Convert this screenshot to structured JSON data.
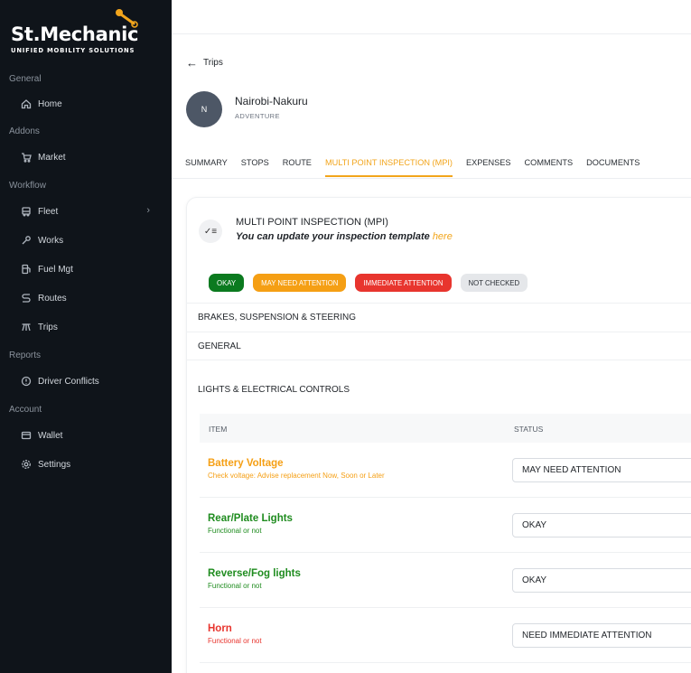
{
  "brand": {
    "name": "St.Mechanic",
    "tagline": "UNIFIED MOBILITY SOLUTIONS",
    "accent": "#f2a51c",
    "sidebar_bg": "#0f141a"
  },
  "sidebar": {
    "sections": [
      {
        "label": "General",
        "items": [
          {
            "label": "Home",
            "icon": "home-icon"
          }
        ]
      },
      {
        "label": "Addons",
        "items": [
          {
            "label": "Market",
            "icon": "cart-icon"
          }
        ]
      },
      {
        "label": "Workflow",
        "items": [
          {
            "label": "Fleet",
            "icon": "bus-icon"
          },
          {
            "label": "Works",
            "icon": "wrench-icon"
          },
          {
            "label": "Fuel Mgt",
            "icon": "fuel-icon"
          },
          {
            "label": "Routes",
            "icon": "route-icon"
          },
          {
            "label": "Trips",
            "icon": "trips-icon"
          }
        ]
      },
      {
        "label": "Reports",
        "items": [
          {
            "label": "Driver Conflicts",
            "icon": "alert-circle-icon"
          }
        ]
      },
      {
        "label": "Account",
        "items": [
          {
            "label": "Wallet",
            "icon": "wallet-icon"
          },
          {
            "label": "Settings",
            "icon": "gear-icon"
          }
        ]
      }
    ]
  },
  "header": {
    "back_label": "Trips"
  },
  "trip": {
    "avatar_initial": "N",
    "name": "Nairobi-Nakuru",
    "type": "ADVENTURE"
  },
  "tabs": [
    "SUMMARY",
    "STOPS",
    "ROUTE",
    "MULTI POINT INSPECTION (MPI)",
    "EXPENSES",
    "COMMENTS",
    "DOCUMENTS"
  ],
  "active_tab": "MULTI POINT INSPECTION (MPI)",
  "mpi": {
    "title": "MULTI POINT INSPECTION (MPI)",
    "subtitle": "You can update your inspection template",
    "link": "here",
    "legend": [
      "OKAY",
      "MAY NEED ATTENTION",
      "IMMEDIATE ATTENTION",
      "NOT CHECKED"
    ],
    "groups": [
      "BRAKES, SUSPENSION & STEERING",
      "GENERAL"
    ],
    "open_group": "LIGHTS & ELECTRICAL CONTROLS",
    "table": {
      "headers": [
        "ITEM",
        "STATUS"
      ],
      "rows": [
        {
          "name": "Battery Voltage",
          "desc": "Check voltage: Advise replacement Now, Soon or Later",
          "status": "MAY NEED ATTENTION",
          "color": "#f59f14"
        },
        {
          "name": "Rear/Plate Lights",
          "desc": "Functional or not",
          "status": "OKAY",
          "color": "#1f8c1f"
        },
        {
          "name": "Reverse/Fog lights",
          "desc": "Functional or not",
          "status": "OKAY",
          "color": "#1f8c1f"
        },
        {
          "name": "Horn",
          "desc": "Functional or not",
          "status": "NEED IMMEDIATE ATTENTION",
          "color": "#e8352e"
        }
      ]
    }
  }
}
